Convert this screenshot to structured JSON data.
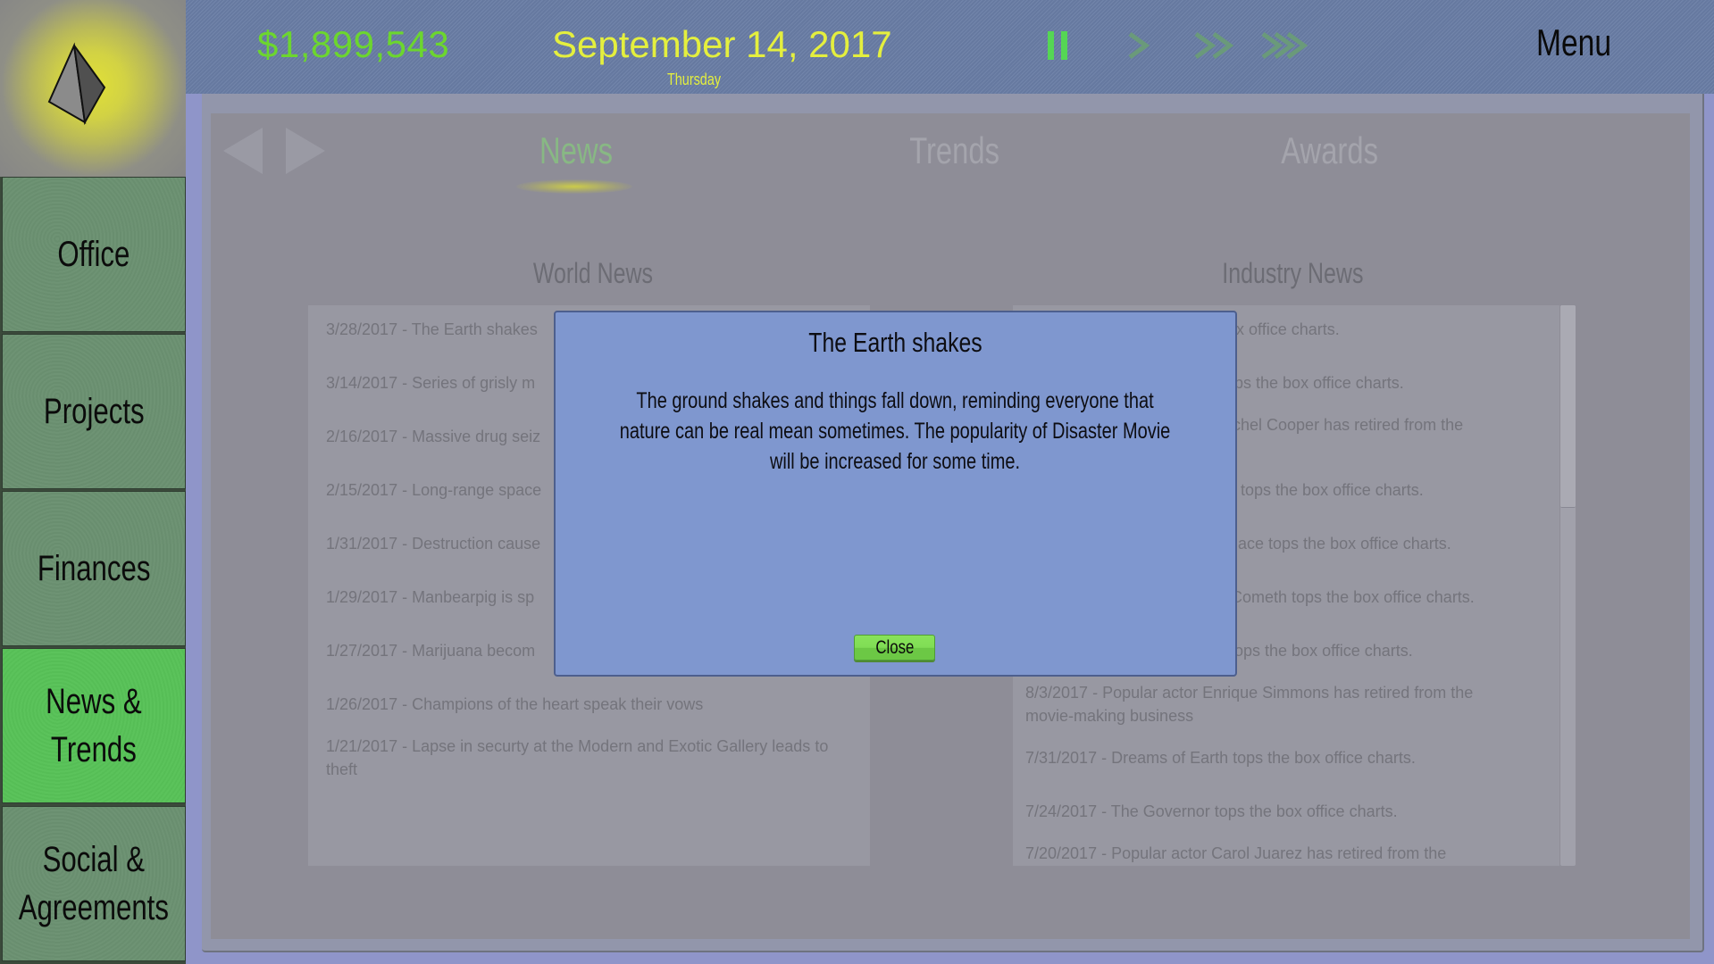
{
  "header": {
    "money": "$1,899,543",
    "date": "September 14, 2017",
    "weekday": "Thursday",
    "speed_controls": [
      {
        "name": "pause",
        "icon": "pause-icon",
        "active": true
      },
      {
        "name": "play",
        "icon": "play-icon",
        "active": false
      },
      {
        "name": "fast-forward",
        "icon": "fast-forward-icon",
        "active": false
      },
      {
        "name": "fastest",
        "icon": "fastest-forward-icon",
        "active": false
      }
    ],
    "menu_label": "Menu"
  },
  "logo": {
    "icon": "pyramid-icon"
  },
  "sidebar": {
    "items": [
      {
        "label": "Office",
        "active": false
      },
      {
        "label": "Projects",
        "active": false
      },
      {
        "label": "Finances",
        "active": false
      },
      {
        "label": "News &\nTrends",
        "active": true
      },
      {
        "label": "Social &\nAgreements",
        "active": false
      }
    ]
  },
  "main": {
    "nav": {
      "back_icon": "back-arrow-icon",
      "forward_icon": "forward-arrow-icon"
    },
    "tabs": [
      {
        "label": "News",
        "active": true
      },
      {
        "label": "Trends",
        "active": false
      },
      {
        "label": "Awards",
        "active": false
      }
    ],
    "world_news": {
      "title": "World News",
      "items": [
        "3/28/2017 - The Earth shakes",
        "3/14/2017 - Series of grisly m",
        "2/16/2017 - Massive drug seiz",
        "2/15/2017 - Long-range space",
        "1/31/2017 - Destruction cause",
        "1/29/2017 - Manbearpig is sp",
        "1/27/2017 - Marijuana becom",
        "1/26/2017 - Champions of the heart speak their vows",
        "1/21/2017 - Lapse in securty at the Modern and Exotic Gallery leads to theft"
      ]
    },
    "industry_news": {
      "title": "Industry News",
      "items": [
        "box office charts.",
        "ops the box office charts.",
        "chel Cooper has retired from the",
        "tops the box office charts.",
        "ace tops the box office charts.",
        "Cometh tops the box office charts.",
        "ops the box office charts.",
        "8/3/2017 - Popular actor Enrique Simmons has retired from the movie-making business",
        "7/31/2017 - Dreams of Earth tops the box office charts.",
        "7/24/2017 - The Governor tops the box office charts.",
        "7/20/2017 - Popular actor Carol Juarez has retired from the"
      ],
      "scroll_position_fraction": 0.0,
      "visible_fraction": 0.36
    }
  },
  "modal": {
    "title": "The Earth shakes",
    "body": "The ground shakes and things fall down, reminding everyone that nature can be real mean sometimes.  The popularity of Disaster Movie will be increased for some time.",
    "close_label": "Close"
  },
  "colors": {
    "money": "#6cd62e",
    "date": "#e4ef3e",
    "speed_active": "#55d654",
    "speed_inactive": "#6a9a7a",
    "sidebar_button": "#6b9171",
    "sidebar_active": "#58c258",
    "modal_bg": "#7f97cf",
    "close_button": "#7fdc52"
  }
}
